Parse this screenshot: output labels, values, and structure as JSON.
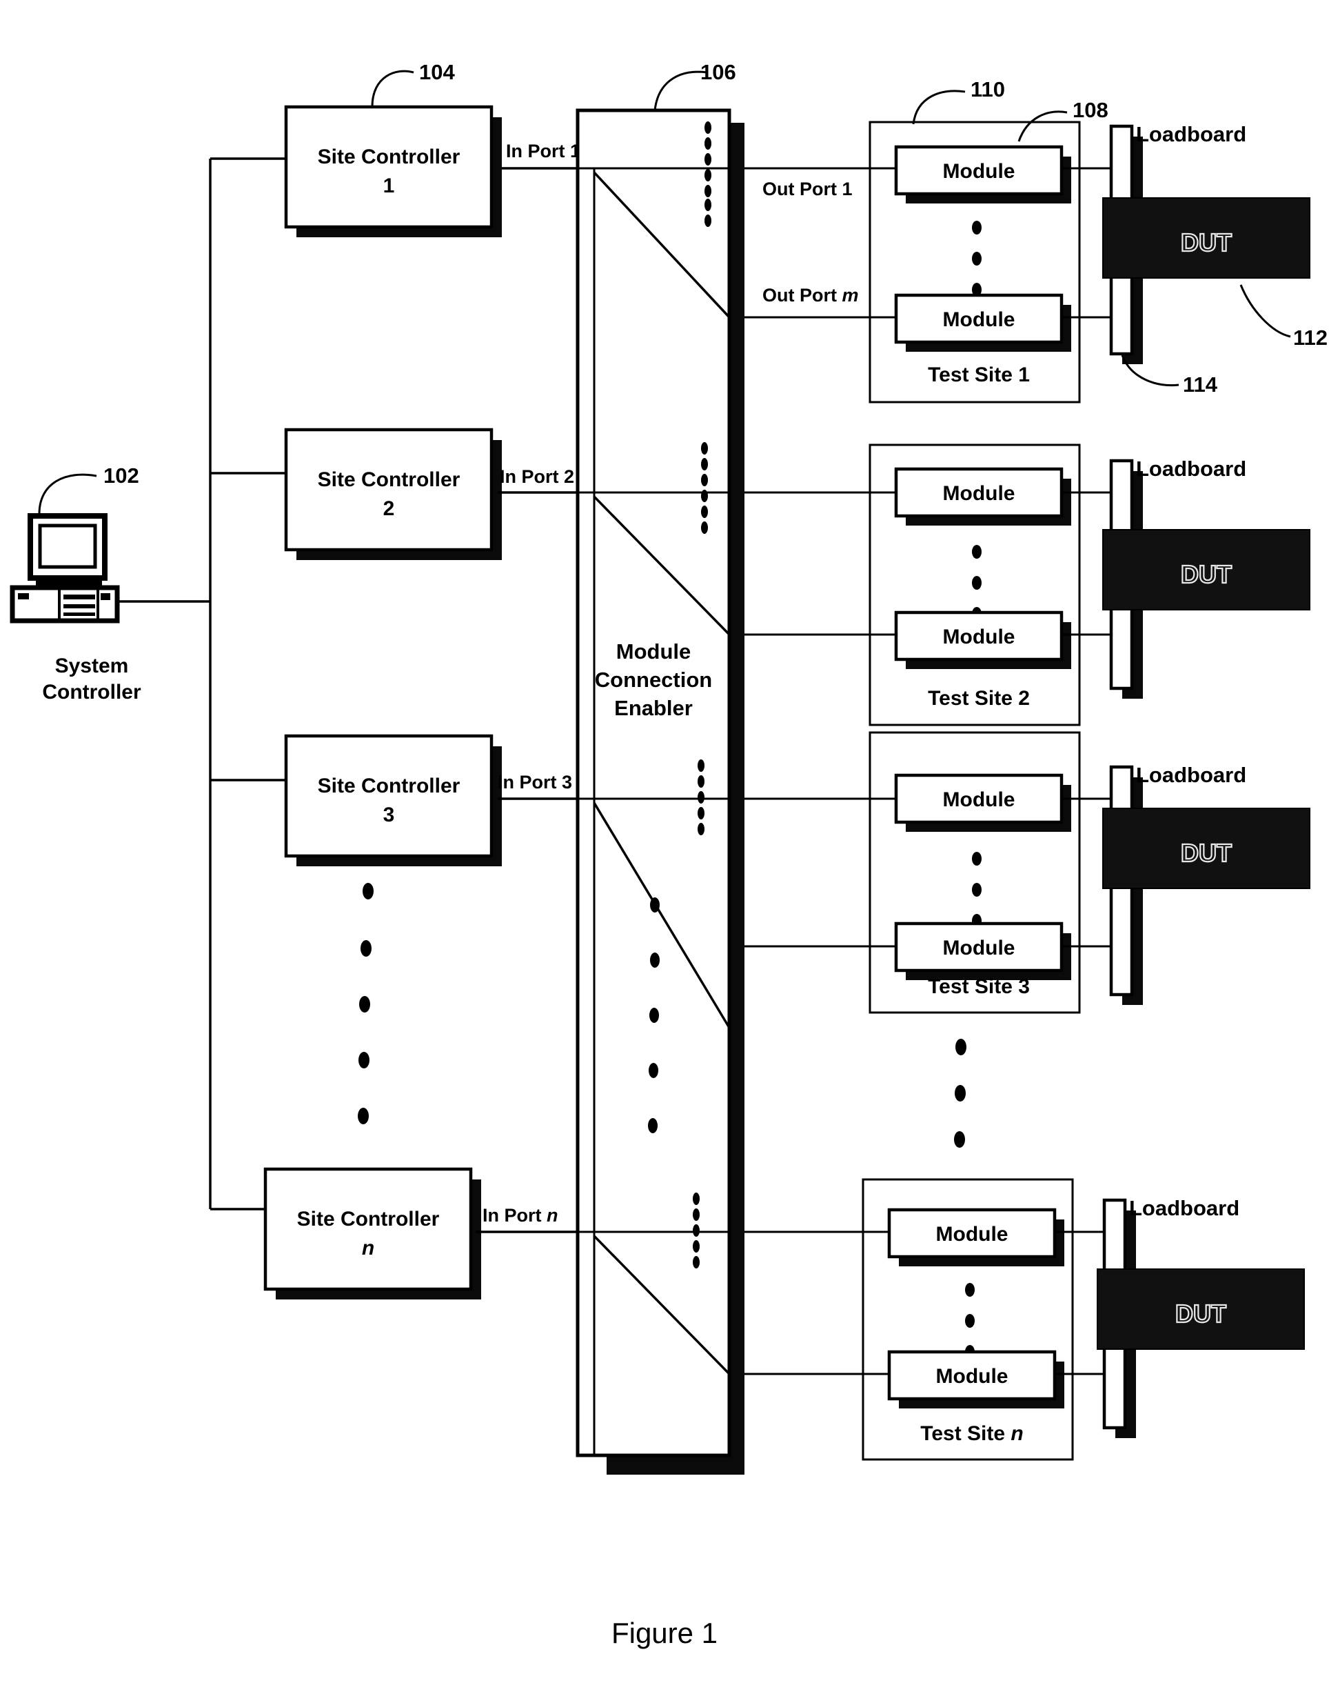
{
  "figure": {
    "caption": "Figure 1"
  },
  "system_controller": {
    "label_line1": "System",
    "label_line2": "Controller",
    "ref": "102",
    "icon": "desktop-computer-icon"
  },
  "site_controllers": [
    {
      "line1": "Site Controller",
      "line2": "1",
      "ref": "104",
      "port": "In Port 1"
    },
    {
      "line1": "Site Controller",
      "line2": "2",
      "ref": "",
      "port": "In Port 2"
    },
    {
      "line1": "Site Controller",
      "line2": "3",
      "ref": "",
      "port": "In Port 3"
    },
    {
      "line1": "Site Controller",
      "line2": "n",
      "ref": "",
      "port": "In Port n",
      "italic_line2": true,
      "italic_port_suffix": true
    }
  ],
  "module_connection_enabler": {
    "label_line1": "Module",
    "label_line2": "Connection",
    "label_line3": "Enabler",
    "ref": "106",
    "out_port_first": "Out Port 1",
    "out_port_last": "Out Port m"
  },
  "test_sites": [
    {
      "title": "Test Site 1",
      "modules": [
        "Module",
        "Module"
      ],
      "loadboard": "Loadboard",
      "dut": "DUT",
      "refs": {
        "site": "110",
        "module": "108",
        "dut": "112",
        "loadboard": "114"
      }
    },
    {
      "title": "Test Site 2",
      "modules": [
        "Module",
        "Module"
      ],
      "loadboard": "Loadboard",
      "dut": "DUT",
      "refs": {}
    },
    {
      "title": "Test Site 3",
      "modules": [
        "Module",
        "Module"
      ],
      "loadboard": "Loadboard",
      "dut": "DUT",
      "refs": {}
    },
    {
      "title": "Test Site n",
      "title_italic_suffix": true,
      "modules": [
        "Module",
        "Module"
      ],
      "loadboard": "Loadboard",
      "dut": "DUT",
      "refs": {}
    }
  ],
  "colors": {
    "ink": "#000000",
    "paper": "#ffffff",
    "dut_fill": "#111111"
  }
}
